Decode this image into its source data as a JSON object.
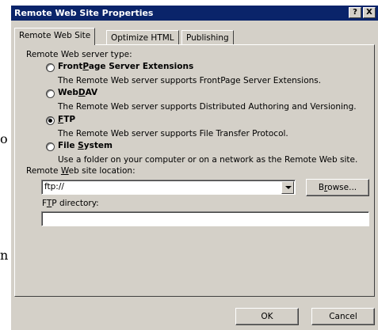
{
  "window": {
    "title": "Remote Web Site Properties",
    "help_glyph": "?",
    "close_glyph": "X"
  },
  "tabs": [
    {
      "label": "Remote Web Site",
      "active": true
    },
    {
      "label": "Optimize HTML",
      "active": false
    },
    {
      "label": "Publishing",
      "active": false
    }
  ],
  "server_type": {
    "label": "Remote Web server type:",
    "options": [
      {
        "pre": "Front",
        "mnemonic": "P",
        "post": "age Server Extensions",
        "desc": "The Remote Web server supports FrontPage Server Extensions.",
        "checked": false
      },
      {
        "pre": "Web",
        "mnemonic": "D",
        "post": "AV",
        "desc": "The Remote Web server supports Distributed Authoring and Versioning.",
        "checked": false
      },
      {
        "pre": "",
        "mnemonic": "F",
        "post": "TP",
        "desc": "The Remote Web server supports File Transfer Protocol.",
        "checked": true
      },
      {
        "pre": "File ",
        "mnemonic": "S",
        "post": "ystem",
        "desc": "Use a folder on your computer or on a network as the Remote Web site.",
        "checked": false
      }
    ]
  },
  "location": {
    "label_pre": "Remote ",
    "label_mnemonic": "W",
    "label_post": "eb site location:",
    "value": "ftp://",
    "browse_pre": "B",
    "browse_mnemonic": "r",
    "browse_post": "owse..."
  },
  "ftp_dir": {
    "label_pre": "F",
    "label_mnemonic": "T",
    "label_post": "P directory:",
    "value": ""
  },
  "footer": {
    "ok_label": "OK",
    "cancel_label": "Cancel"
  },
  "background_fragments": [
    "o",
    "n"
  ]
}
